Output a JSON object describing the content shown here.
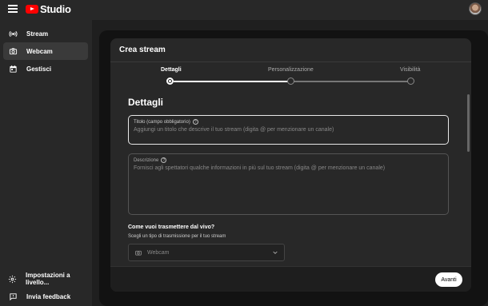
{
  "app": {
    "title": "Studio"
  },
  "sidebar": {
    "items": [
      {
        "label": "Stream",
        "icon": "broadcast-icon"
      },
      {
        "label": "Webcam",
        "icon": "camera-icon"
      },
      {
        "label": "Gestisci",
        "icon": "calendar-icon"
      }
    ],
    "bottom_items": [
      {
        "label": "Impostazioni a livello...",
        "icon": "gear-icon"
      },
      {
        "label": "Invia feedback",
        "icon": "feedback-icon"
      }
    ]
  },
  "dialog": {
    "title": "Crea stream",
    "steps": [
      {
        "label": "Dettagli",
        "active": true
      },
      {
        "label": "Personalizzazione",
        "active": false
      },
      {
        "label": "Visibilità",
        "active": false
      }
    ],
    "section_title": "Dettagli",
    "title_field": {
      "label": "Titolo (campo obbligatorio)",
      "placeholder": "Aggiungi un titolo che descrive il tuo stream (digita @ per menzionare un canale)"
    },
    "description_field": {
      "label": "Descrizione",
      "placeholder": "Fornisci agli spettatori qualche informazioni in più sul tuo stream (digita @ per menzionare un canale)"
    },
    "how": {
      "title": "Come vuoi trasmettere dal vivo?",
      "subtitle": "Scegli un tipo di trasmissione per il tuo stream",
      "selected": "Webcam"
    },
    "next_label": "Avanti"
  },
  "colors": {
    "brand": "#ff0000",
    "background": "#282828",
    "dialog": "#282828"
  }
}
